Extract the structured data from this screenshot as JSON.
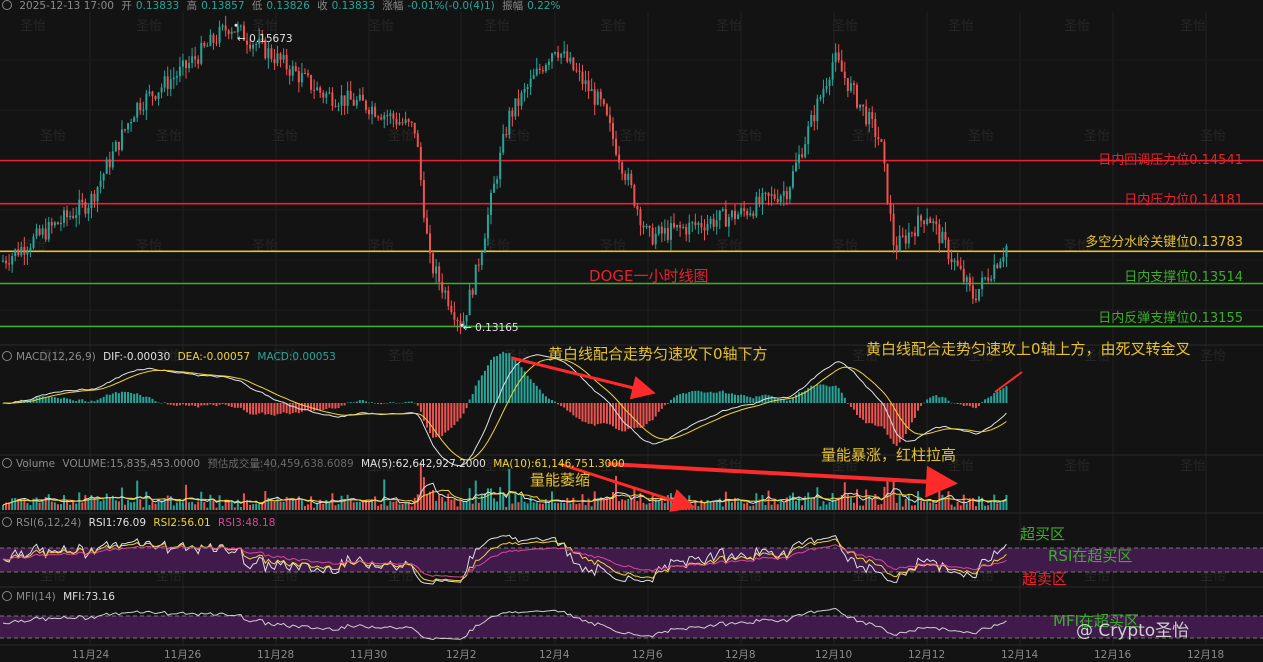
{
  "header": {
    "datetime": "2025-12-13 17:00",
    "open_label": "开",
    "open": "0.13833",
    "high_label": "高",
    "high": "0.13857",
    "low_label": "低",
    "low": "0.13826",
    "close_label": "收",
    "close": "0.13833",
    "change_label": "涨幅",
    "change": "-0.01%(-0.0(4)1)",
    "amp_label": "振幅",
    "amp": "0.22%"
  },
  "main": {
    "title": "DOGE一小时线图",
    "high_marker": "0.15673",
    "low_marker": "0.13165"
  },
  "levels": [
    {
      "label": "日内回调压力位0.14541",
      "price": 0.14541,
      "color": "#e8222e"
    },
    {
      "label": "日内压力位0.14181",
      "price": 0.14181,
      "color": "#e8222e"
    },
    {
      "label": "多空分水岭关键位0.13783",
      "price": 0.13783,
      "color": "#e6c230"
    },
    {
      "label": "日内支撑位0.13514",
      "price": 0.13514,
      "color": "#3cae2c"
    },
    {
      "label": "日内反弹支撑位0.13155",
      "price": 0.13155,
      "color": "#3cae2c"
    }
  ],
  "macd": {
    "name": "MACD(12,26,9)",
    "dif": "DIF:-0.00030",
    "dea": "DEA:-0.00057",
    "macd": "MACD:0.00053",
    "annotation_left": "黄白线配合走势匀速攻下0轴下方",
    "annotation_right": "黄白线配合走势匀速攻上0轴上方，由死叉转金叉"
  },
  "volume": {
    "name": "Volume",
    "volume": "VOLUME:15,835,453.0000",
    "estimate": "预估成交量:40,459,638.6089",
    "ma5": "MA(5):62,642,927.2000",
    "ma10": "MA(10):61,146,751.3000",
    "annotation_shrink": "量能萎缩",
    "annotation_surge": "量能暴涨，红柱拉高"
  },
  "rsi": {
    "name": "RSI(6,12,24)",
    "rsi1": "RSI1:76.09",
    "rsi2": "RSI2:56.01",
    "rsi3": "RSI3:48.18",
    "overbought": "超买区",
    "in_overbought": "RSI在超买区",
    "oversold": "超卖区"
  },
  "mfi": {
    "name": "MFI(14)",
    "mfi": "MFI:73.16",
    "in_overbought": "MFI在超买区"
  },
  "xaxis": [
    "11月24",
    "11月26",
    "11月28",
    "11月30",
    "12月2",
    "12月4",
    "12月6",
    "12月8",
    "12月10",
    "12月12",
    "12月14",
    "12月16",
    "12月18"
  ],
  "watermark": "@ Crypto圣怡",
  "colors": {
    "up": "#26a69a",
    "down": "#ef5350",
    "dif": "#e0e0e0",
    "dea": "#f0d43a",
    "rsi_zone": "#3f1a4a",
    "mfi_line": "#cfcfcf"
  },
  "chart_data": {
    "type": "candlestick",
    "title": "DOGE一小时线图",
    "interval": "1h",
    "price_path_keypoints": [
      {
        "date": "11月23",
        "price": 0.137
      },
      {
        "date": "11月24",
        "price": 0.142
      },
      {
        "date": "11月25",
        "price": 0.15
      },
      {
        "date": "11月26",
        "price": 0.153
      },
      {
        "date": "11月27",
        "price": 0.15673
      },
      {
        "date": "11月28",
        "price": 0.154
      },
      {
        "date": "11月29",
        "price": 0.151
      },
      {
        "date": "11月30",
        "price": 0.15
      },
      {
        "date": "12月1",
        "price": 0.148
      },
      {
        "date": "12月1",
        "price": 0.137
      },
      {
        "date": "12月2",
        "price": 0.13165
      },
      {
        "date": "12月2",
        "price": 0.136
      },
      {
        "date": "12月3",
        "price": 0.149
      },
      {
        "date": "12月4",
        "price": 0.155
      },
      {
        "date": "12月5",
        "price": 0.15
      },
      {
        "date": "12月6",
        "price": 0.139
      },
      {
        "date": "12月7",
        "price": 0.14
      },
      {
        "date": "12月8",
        "price": 0.141
      },
      {
        "date": "12月9",
        "price": 0.143
      },
      {
        "date": "12月10",
        "price": 0.154
      },
      {
        "date": "12月11",
        "price": 0.147
      },
      {
        "date": "12月11",
        "price": 0.138
      },
      {
        "date": "12月12",
        "price": 0.141
      },
      {
        "date": "12月13",
        "price": 0.134
      },
      {
        "date": "12月13",
        "price": 0.13833
      }
    ],
    "horizontal_levels": [
      0.14541,
      0.14181,
      0.13783,
      0.13514,
      0.13155
    ],
    "last": {
      "datetime": "2025-12-13 17:00",
      "open": 0.13833,
      "high": 0.13857,
      "low": 0.13826,
      "close": 0.13833
    },
    "indicators": {
      "macd": {
        "dif": -0.0003,
        "dea": -0.00057,
        "macd": 0.00053
      },
      "volume": {
        "volume": 15835453.0,
        "estimate": 40459638.6089,
        "ma5": 62642927.2,
        "ma10": 61146751.3
      },
      "rsi": {
        "rsi1": 76.09,
        "rsi2": 56.01,
        "rsi3": 48.18
      },
      "mfi": {
        "mfi": 73.16
      }
    },
    "x_ticks": [
      "11月24",
      "11月26",
      "11月28",
      "11月30",
      "12月2",
      "12月4",
      "12月6",
      "12月8",
      "12月10",
      "12月12",
      "12月14",
      "12月16",
      "12月18"
    ]
  }
}
